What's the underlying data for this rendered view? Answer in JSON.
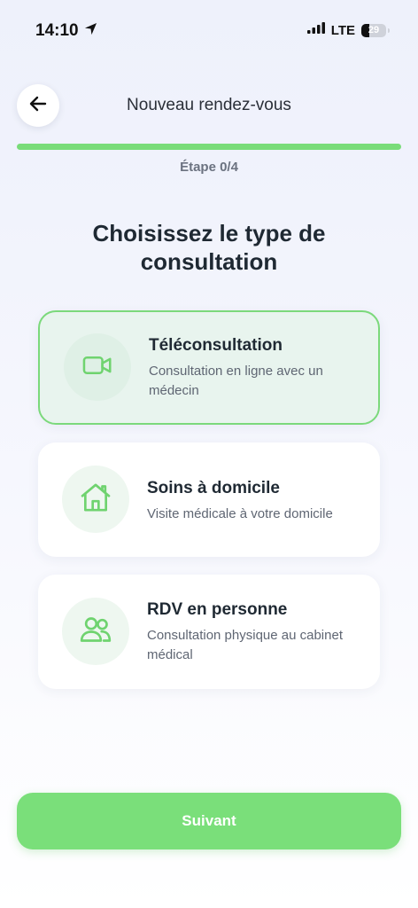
{
  "status_bar": {
    "time": "14:10",
    "network": "LTE",
    "battery_level": "29"
  },
  "header": {
    "title": "Nouveau rendez-vous",
    "back_icon": "arrow-left-icon"
  },
  "progress": {
    "step_label": "Étape 0/4",
    "fraction": 1.0,
    "color": "#79dc79"
  },
  "page_title": "Choisissez le type de consultation",
  "options": [
    {
      "title": "Téléconsultation",
      "description": "Consultation en ligne avec un médecin",
      "icon": "video-camera-icon",
      "selected": true
    },
    {
      "title": "Soins à domicile",
      "description": "Visite médicale à votre domicile",
      "icon": "home-icon",
      "selected": false
    },
    {
      "title": "RDV en personne",
      "description": "Consultation physique au cabinet médical",
      "icon": "users-icon",
      "selected": false
    }
  ],
  "next_button": {
    "label": "Suivant"
  },
  "colors": {
    "accent": "#7adf7a",
    "selected_background": "#e8f4ee",
    "icon_stroke": "#6fd36f"
  }
}
